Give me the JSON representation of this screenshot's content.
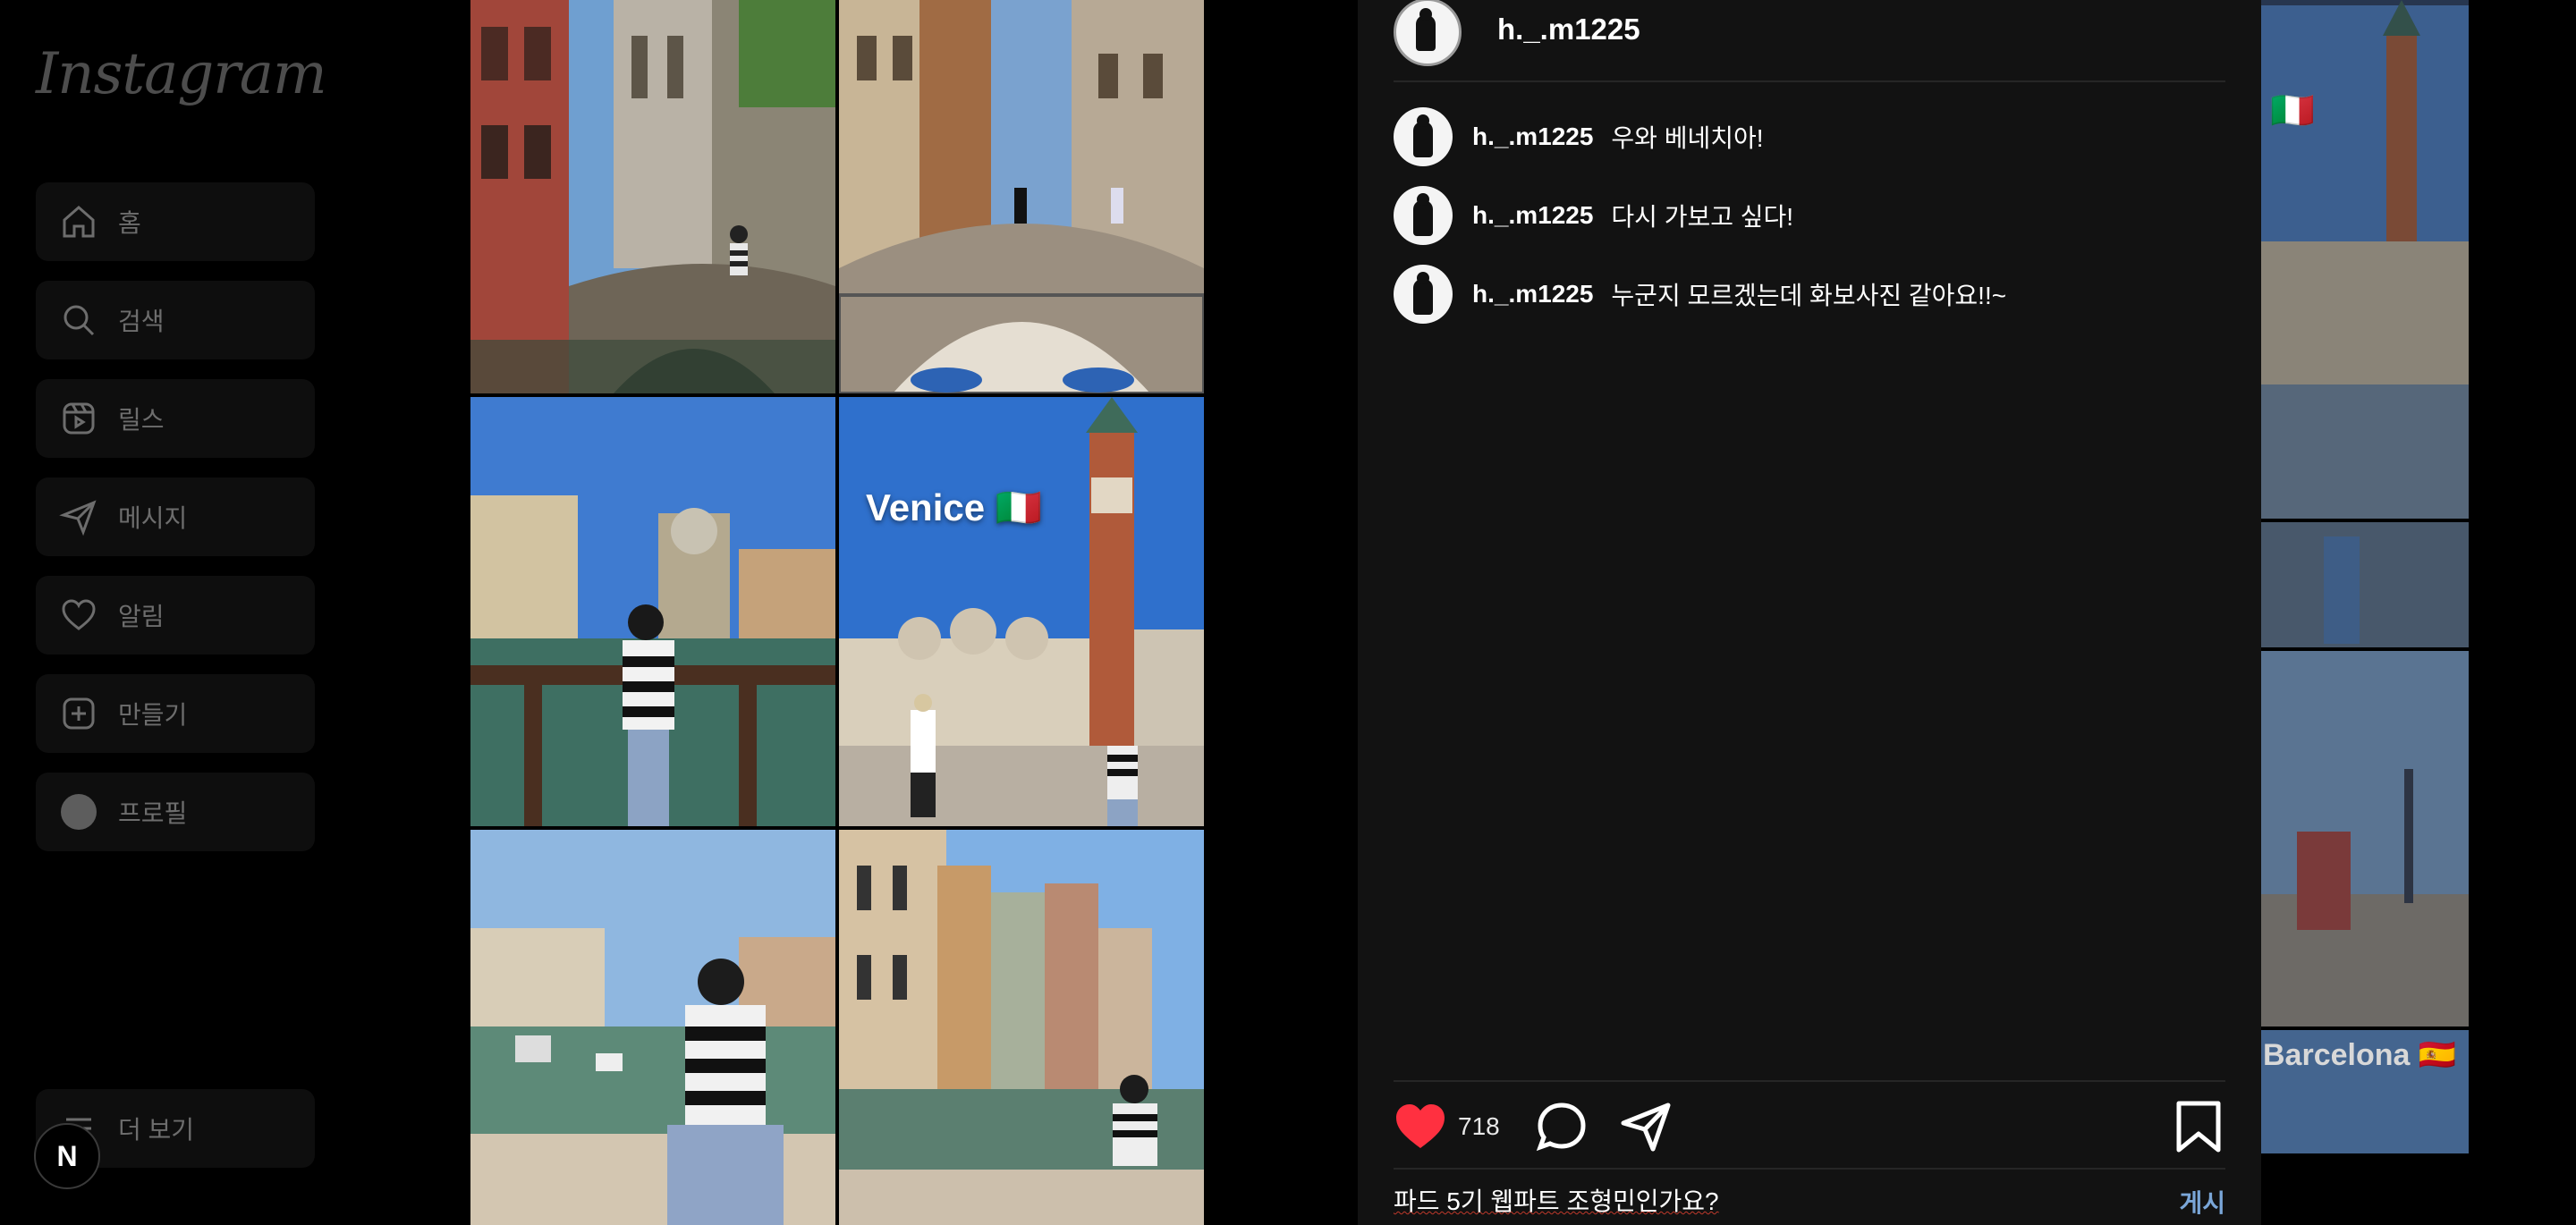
{
  "app": {
    "logo": "Instagram"
  },
  "sidebar": {
    "items": [
      {
        "label": "홈",
        "icon": "home-icon"
      },
      {
        "label": "검색",
        "icon": "search-icon"
      },
      {
        "label": "릴스",
        "icon": "reels-icon"
      },
      {
        "label": "메시지",
        "icon": "send-icon"
      },
      {
        "label": "알림",
        "icon": "heart-icon"
      },
      {
        "label": "만들기",
        "icon": "plus-square-icon"
      },
      {
        "label": "프로필",
        "icon": "avatar"
      }
    ],
    "more_label": "더 보기",
    "badge_letter": "N"
  },
  "collage": {
    "overlay_text": "Venice 🇮🇹"
  },
  "post": {
    "author": "h._.m1225",
    "comments": [
      {
        "user": "h._.m1225",
        "text": "우와 베네치아!"
      },
      {
        "user": "h._.m1225",
        "text": "다시 가보고 싶다!"
      },
      {
        "user": "h._.m1225",
        "text": "누군지 모르겠는데 화보사진 같아요!!~"
      }
    ],
    "likes": "718",
    "comment_input_value": "파드 5기 웹파트 조형민인가요?",
    "post_label": "게시",
    "like_color": "#ff3040"
  },
  "strip": {
    "flag_text": "🇮🇹",
    "barcelona_text": "Barcelona 🇪🇸"
  }
}
